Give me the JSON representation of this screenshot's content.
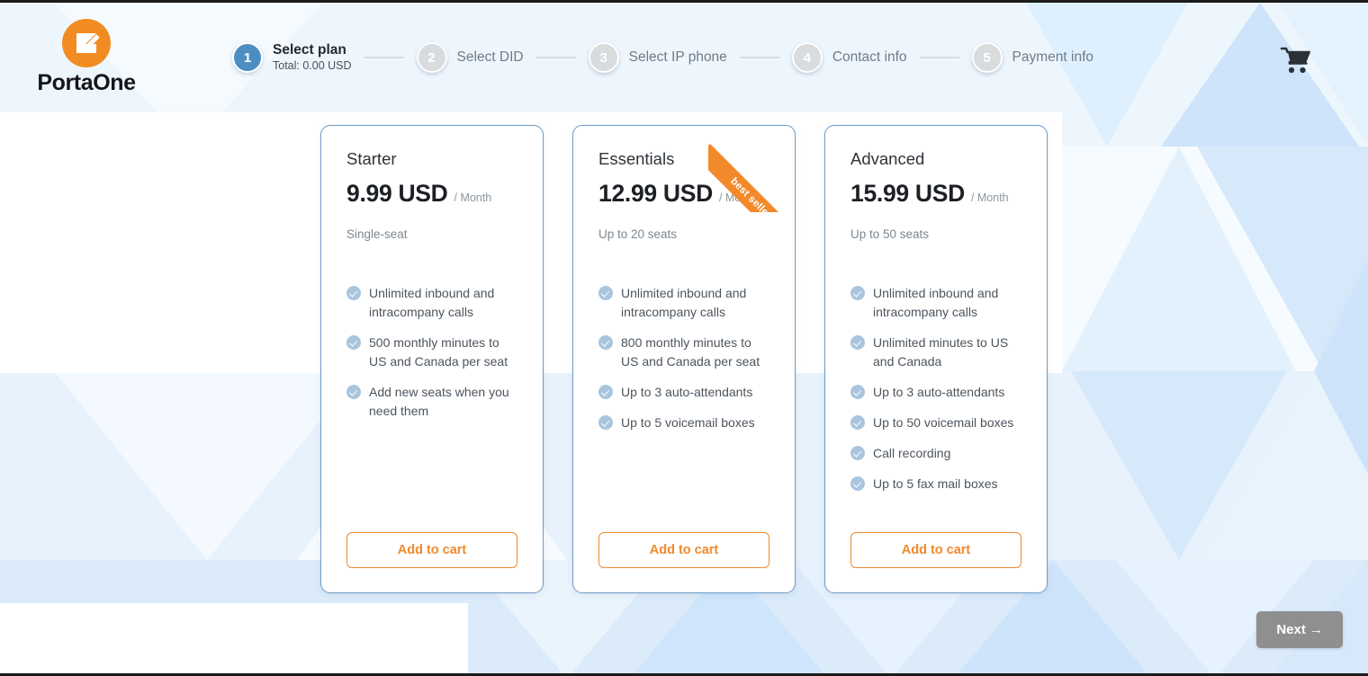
{
  "header": {
    "logo": {
      "icon": "portaone-logo-icon",
      "text": "PortaOne"
    },
    "cart_icon": "shopping-cart-icon",
    "steps": [
      {
        "number": "1",
        "label": "Select plan",
        "sub": "Total: 0.00 USD",
        "active": true
      },
      {
        "number": "2",
        "label": "Select DID",
        "sub": "",
        "active": false
      },
      {
        "number": "3",
        "label": "Select IP phone",
        "sub": "",
        "active": false
      },
      {
        "number": "4",
        "label": "Contact info",
        "sub": "",
        "active": false
      },
      {
        "number": "5",
        "label": "Payment info",
        "sub": "",
        "active": false
      }
    ]
  },
  "plans": [
    {
      "name": "Starter",
      "price": "9.99 USD",
      "period": "/ Month",
      "seats": "Single-seat",
      "badge": null,
      "features": [
        "Unlimited inbound and intracompany calls",
        "500 monthly minutes to US and Canada per seat",
        "Add new seats when you need them"
      ],
      "cta": "Add to cart"
    },
    {
      "name": "Essentials",
      "price": "12.99 USD",
      "period": "/ Month",
      "seats": "Up to 20 seats",
      "badge": "best seller",
      "features": [
        "Unlimited inbound and intracompany calls",
        "800 monthly minutes to US and Canada per seat",
        "Up to 3 auto-attendants",
        "Up to 5 voicemail boxes"
      ],
      "cta": "Add to cart"
    },
    {
      "name": "Advanced",
      "price": "15.99 USD",
      "period": "/ Month",
      "seats": "Up to 50 seats",
      "badge": null,
      "features": [
        "Unlimited inbound and intracompany calls",
        "Unlimited minutes to US and Canada",
        "Up to 3 auto-attendants",
        "Up to 50 voicemail boxes",
        "Call recording",
        "Up to 5 fax mail boxes"
      ],
      "cta": "Add to cart"
    }
  ],
  "footer": {
    "next_label": "Next →"
  },
  "colors": {
    "brand_orange": "#f08a2c",
    "active_step_blue": "#4d8ec2",
    "inactive_step_gray": "#d9dcdf",
    "card_border_blue": "#6e9bc6",
    "check_blue": "#a9c5de",
    "next_disabled_gray": "#8f8f8f",
    "background_blue": "#d7e8f8"
  }
}
